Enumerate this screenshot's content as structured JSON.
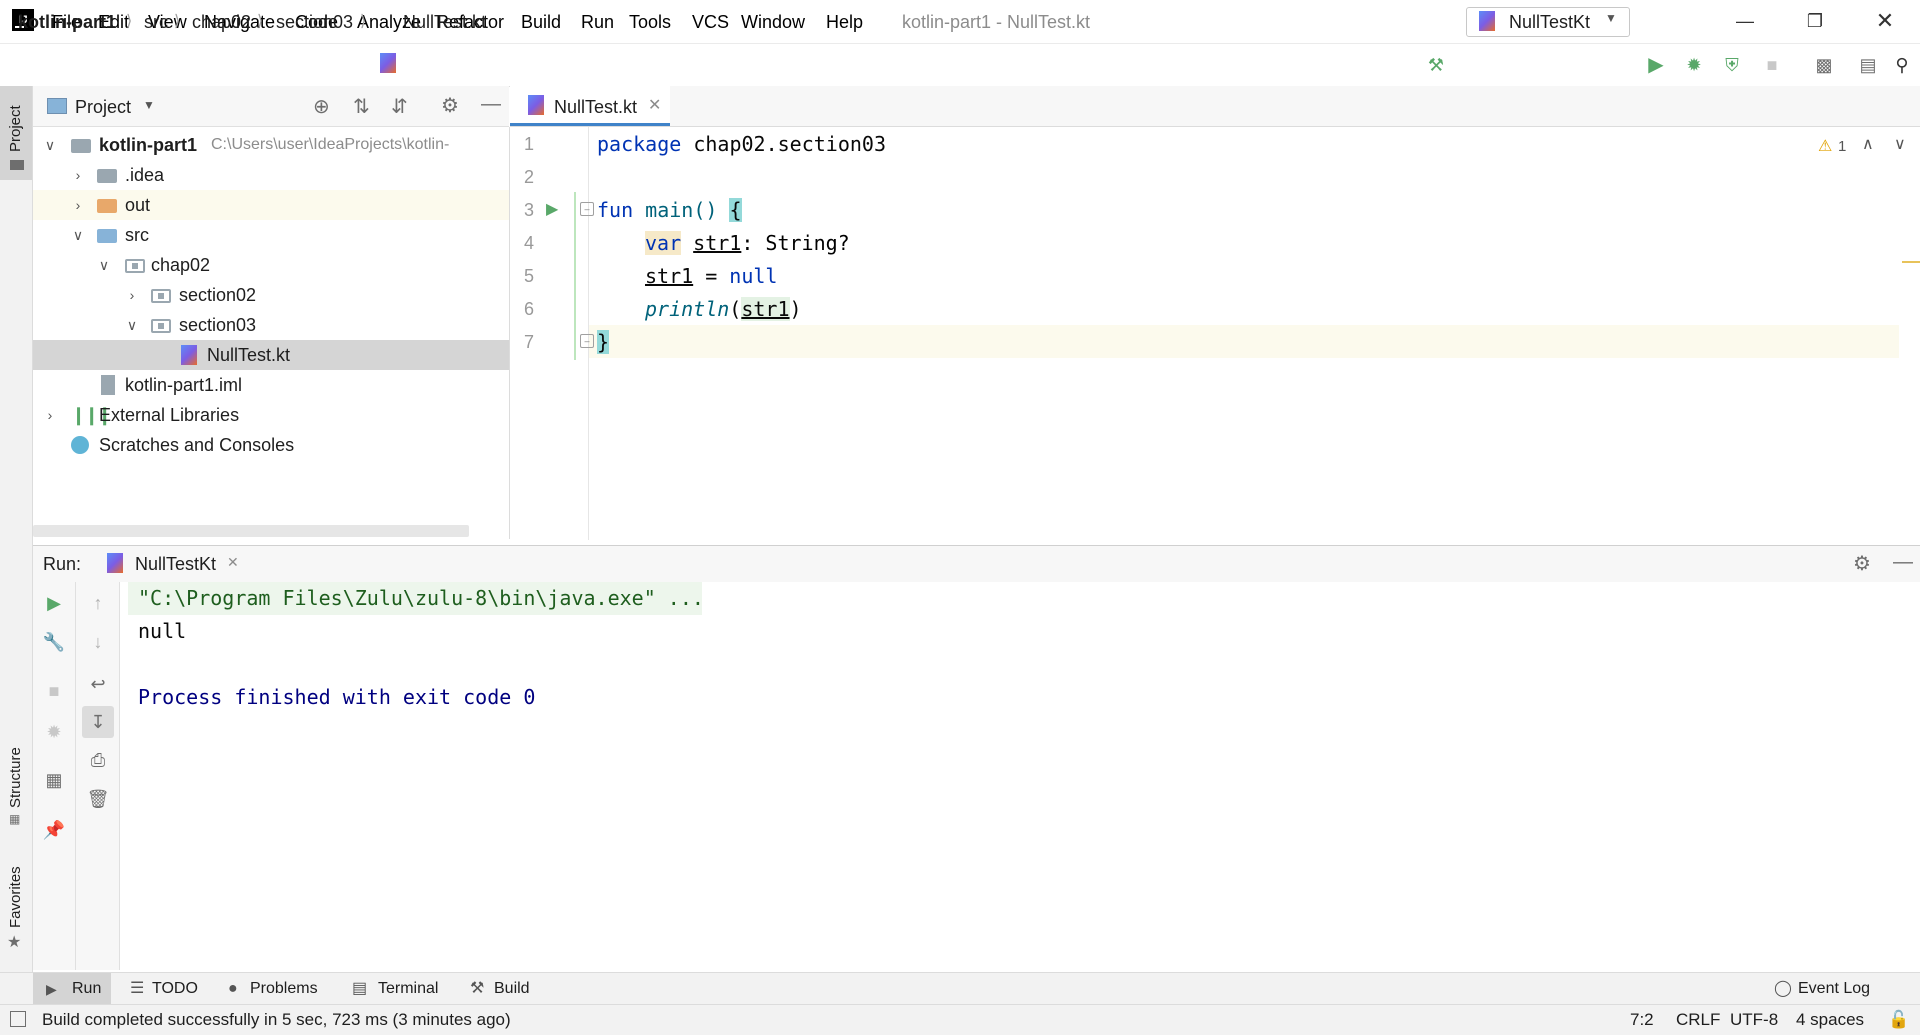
{
  "titlebar": {
    "menu": [
      "File",
      "Edit",
      "View",
      "Navigate",
      "Code",
      "Analyze",
      "Refactor",
      "Build",
      "Run",
      "Tools",
      "VCS",
      "Window",
      "Help"
    ],
    "window_title": "kotlin-part1 - NullTest.kt"
  },
  "navbar": {
    "breadcrumbs": [
      "kotlin-part1",
      "src",
      "chap02",
      "section03",
      "NullTest.kt"
    ],
    "run_config": "NullTestKt"
  },
  "left_strip": {
    "project": "Project",
    "structure": "Structure",
    "favorites": "Favorites"
  },
  "project_panel": {
    "title": "Project",
    "tree": [
      {
        "label": "kotlin-part1",
        "path": "C:\\Users\\user\\IdeaProjects\\kotlin-"
      },
      {
        "label": ".idea"
      },
      {
        "label": "out"
      },
      {
        "label": "src"
      },
      {
        "label": "chap02"
      },
      {
        "label": "section02"
      },
      {
        "label": "section03"
      },
      {
        "label": "NullTest.kt"
      },
      {
        "label": "kotlin-part1.iml"
      },
      {
        "label": "External Libraries"
      },
      {
        "label": "Scratches and Consoles"
      }
    ]
  },
  "editor": {
    "tab": "NullTest.kt",
    "warnings": "1",
    "line_numbers": [
      "1",
      "2",
      "3",
      "4",
      "5",
      "6",
      "7"
    ],
    "code": {
      "l1a": "package",
      "l1b": " chap02.section03",
      "l3a": "fun",
      "l3b": " main() ",
      "l3c": "{",
      "l4a": "var",
      "l4b": "str1",
      "l4c": ": String?",
      "l5a": "str1",
      "l5b": " = ",
      "l5c": "null",
      "l6a": "println",
      "l6b": "(",
      "l6c": "str1",
      "l6d": ")",
      "l7": "}"
    }
  },
  "run_panel": {
    "label": "Run:",
    "tab": "NullTestKt",
    "console": [
      "\"C:\\Program Files\\Zulu\\zulu-8\\bin\\java.exe\" ...",
      "null",
      "",
      "Process finished with exit code 0"
    ]
  },
  "bottom_tabs": [
    "Run",
    "TODO",
    "Problems",
    "Terminal",
    "Build"
  ],
  "event_log": "Event Log",
  "status": {
    "message": "Build completed successfully in 5 sec, 723 ms (3 minutes ago)",
    "position": "7:2",
    "line_sep": "CRLF",
    "encoding": "UTF-8",
    "indent": "4 spaces"
  },
  "colors": {
    "accent": "#4083c9",
    "run_green": "#59a869",
    "keyword": "#0033b3",
    "console_blue": "#000080"
  }
}
